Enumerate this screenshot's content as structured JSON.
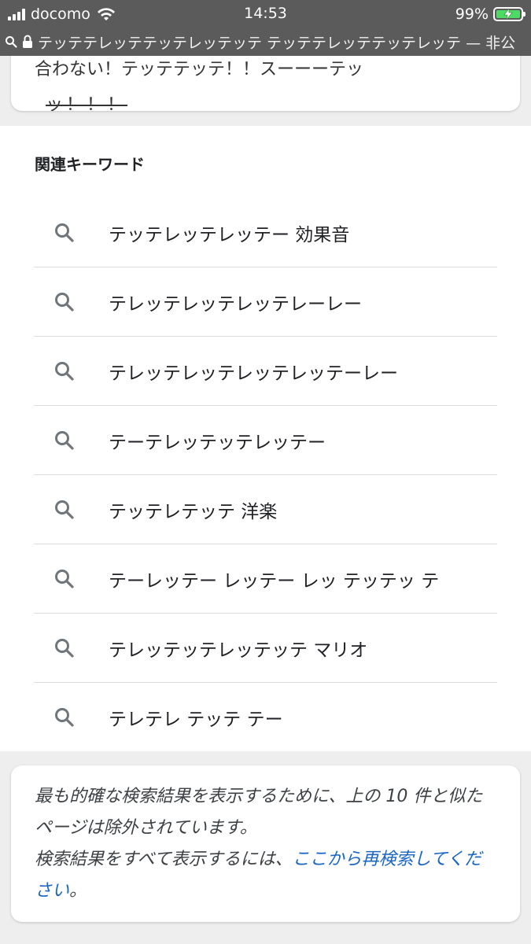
{
  "status_bar": {
    "carrier": "docomo",
    "time": "14:53",
    "battery": "99%",
    "colors": {
      "background": "#5b5b5b",
      "battery_fill": "#4cd964"
    }
  },
  "url_bar": {
    "text": "テッテテレッテテッテレッテッテ テッテテレッテテッテレッテ — 非公"
  },
  "top_card": {
    "line1": "合わない！テッテテッテ！！スーーーテッ",
    "line2": "ッ！！！"
  },
  "related": {
    "title": "関連キーワード",
    "items": [
      {
        "label": "テッテレッテレッテー 効果音",
        "icon": "search-icon"
      },
      {
        "label": "テレッテレッテレッテレーレー",
        "icon": "search-icon"
      },
      {
        "label": "テレッテレッテレッテレッテーレー",
        "icon": "search-icon"
      },
      {
        "label": "テーテレッテッテレッテー",
        "icon": "search-icon"
      },
      {
        "label": "テッテレテッテ 洋楽",
        "icon": "search-icon"
      },
      {
        "label": "テーレッテー レッテー レッ テッテッ テ",
        "icon": "search-icon"
      },
      {
        "label": "テレッテッテレッテッテ マリオ",
        "icon": "search-icon"
      },
      {
        "label": "テレテレ テッテ テー",
        "icon": "search-icon"
      }
    ]
  },
  "notice": {
    "text1": "最も的確な検索結果を表示するために、上の 10 件と似たページは除外されています。",
    "text2": "検索結果をすべて表示するには、",
    "link": "ここから再検索してください",
    "text3": "。",
    "colors": {
      "link": "#1a66c2"
    }
  }
}
